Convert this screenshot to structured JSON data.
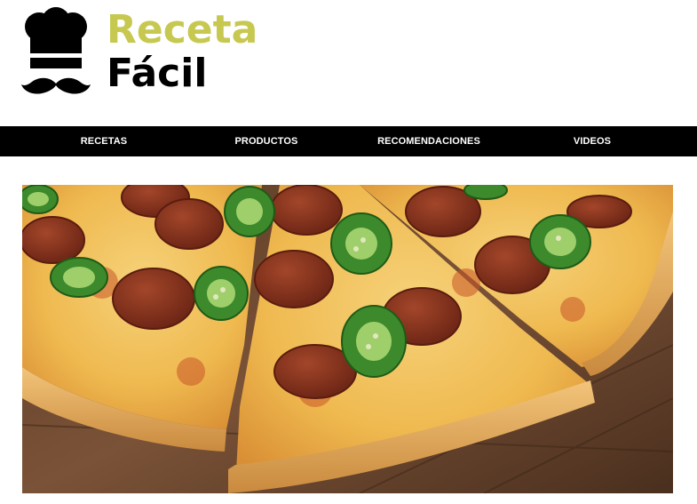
{
  "logo": {
    "line1": "Receta",
    "line2": "Fácil",
    "icon": "chef-hat-mustache-icon",
    "accent_color": "#c6c850",
    "dark_color": "#000000"
  },
  "nav": {
    "items": [
      {
        "label": "RECETAS"
      },
      {
        "label": "PRODUCTOS"
      },
      {
        "label": "RECOMENDACIONES"
      },
      {
        "label": "VIDEOS"
      }
    ],
    "background": "#000000",
    "text_color": "#ffffff"
  },
  "hero": {
    "subject": "pizza-pepperoni-jalapeno-photo"
  }
}
